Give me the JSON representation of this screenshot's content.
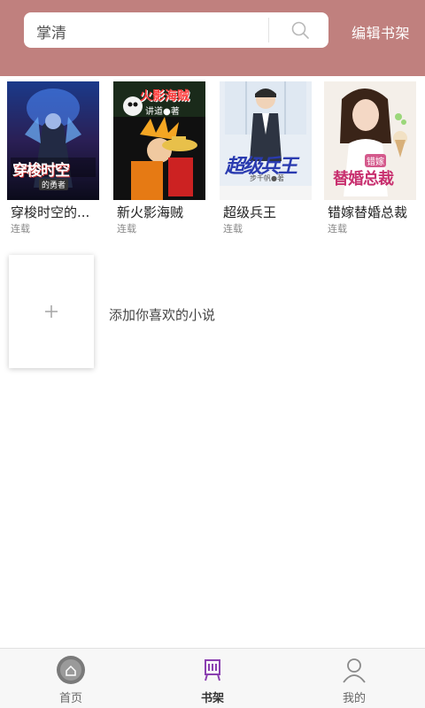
{
  "header": {
    "search_value": "掌清",
    "edit_shelf_label": "编辑书架"
  },
  "books": [
    {
      "title": "穿梭时空的...",
      "status": "连载",
      "cover_text": "穿梭时空",
      "cover_subtext": "的勇者"
    },
    {
      "title": "新火影海贼",
      "status": "连载",
      "cover_text": "火影海贼",
      "cover_subtext": "讲道●著"
    },
    {
      "title": "超级兵王",
      "status": "连载",
      "cover_text": "超级兵王",
      "cover_subtext": "步千帆●著"
    },
    {
      "title": "错嫁替婚总裁",
      "status": "连载",
      "cover_text": "替婚总裁",
      "cover_subtext": "错嫁"
    }
  ],
  "add_card": {
    "label": "添加你喜欢的小说"
  },
  "nav": {
    "items": [
      {
        "label": "首页"
      },
      {
        "label": "书架"
      },
      {
        "label": "我的"
      }
    ]
  },
  "colors": {
    "header_bg": "#c0807e",
    "shelf_accent": "#8a3fb0"
  }
}
